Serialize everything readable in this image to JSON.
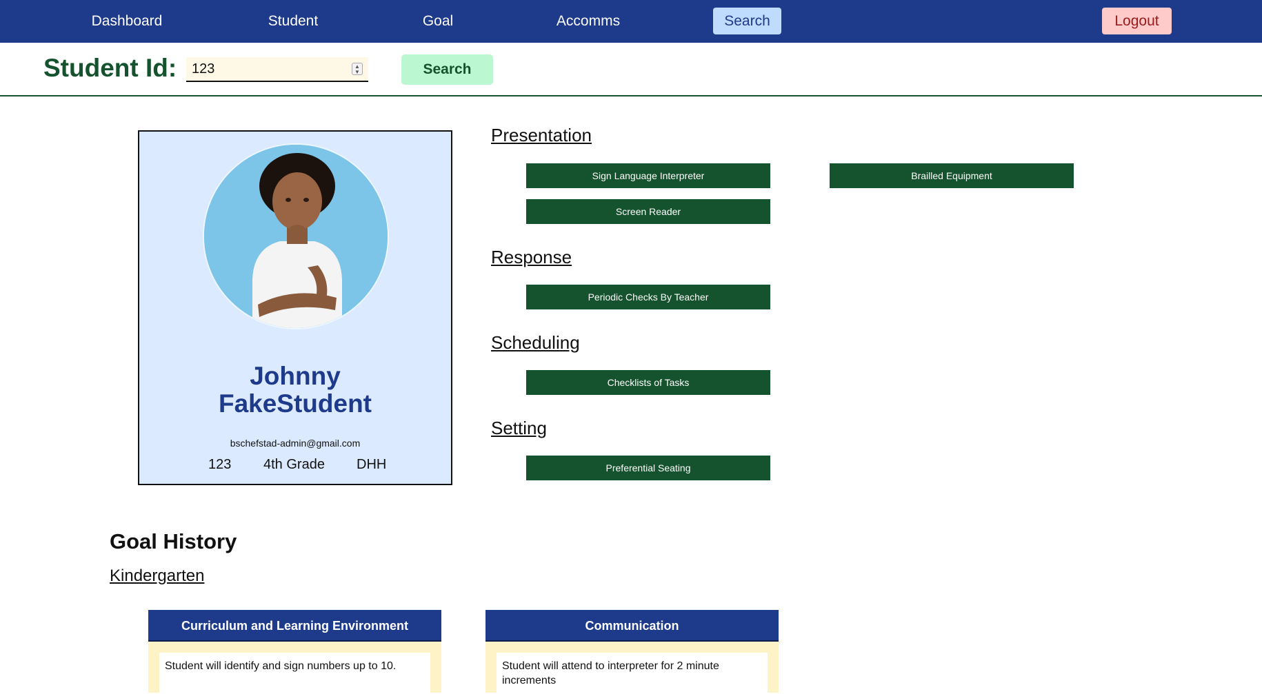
{
  "nav": {
    "items": [
      "Dashboard",
      "Student",
      "Goal",
      "Accomms"
    ],
    "search_label": "Search",
    "logout_label": "Logout"
  },
  "search": {
    "label": "Student Id:",
    "value": "123",
    "button_label": "Search"
  },
  "profile": {
    "first_name": "Johnny",
    "last_name": "FakeStudent",
    "email": "bschefstad-admin@gmail.com",
    "id": "123",
    "grade": "4th Grade",
    "category": "DHH"
  },
  "accommodations": {
    "presentation": {
      "heading": "Presentation",
      "items": [
        "Sign Language Interpreter",
        "Brailled Equipment",
        "Screen Reader"
      ]
    },
    "response": {
      "heading": "Response",
      "items": [
        "Periodic Checks By Teacher"
      ]
    },
    "scheduling": {
      "heading": "Scheduling",
      "items": [
        "Checklists of Tasks"
      ]
    },
    "setting": {
      "heading": "Setting",
      "items": [
        "Preferential Seating"
      ]
    }
  },
  "goal_history": {
    "title": "Goal History",
    "grade": "Kindergarten",
    "goals": [
      {
        "area": "Curriculum and Learning Environment",
        "text": "Student will identify and sign numbers up to 10."
      },
      {
        "area": "Communication",
        "text": "Student will attend to interpreter for 2 minute increments"
      }
    ]
  },
  "colors": {
    "nav_bg": "#1e3a8a",
    "accent_green": "#14532d",
    "card_bg": "#dbeafe",
    "goal_bg": "#fef3c7"
  }
}
